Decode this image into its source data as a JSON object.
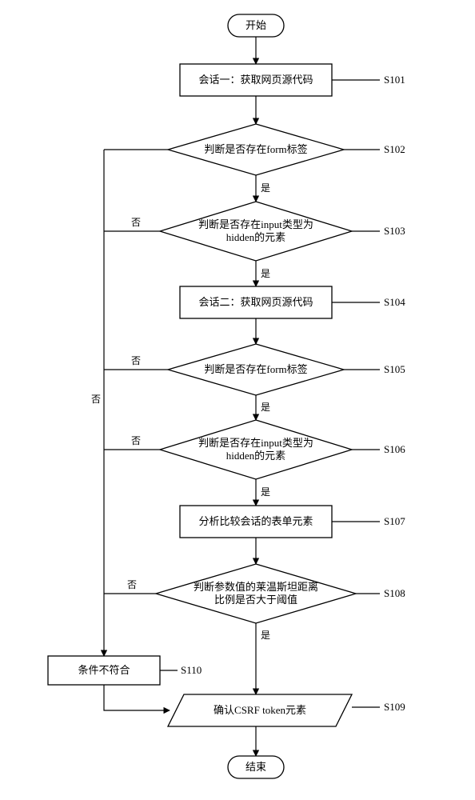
{
  "chart_data": {
    "type": "flowchart",
    "title": "",
    "nodes": [
      {
        "id": "start",
        "type": "terminator",
        "text": "开始"
      },
      {
        "id": "n101",
        "type": "process",
        "text": "会话一：获取网页源代码",
        "label": "S101"
      },
      {
        "id": "n102",
        "type": "decision",
        "text": "判断是否存在form标签",
        "label": "S102"
      },
      {
        "id": "n103",
        "type": "decision",
        "text_l1": "判断是否存在input类型为",
        "text_l2": "hidden的元素",
        "label": "S103"
      },
      {
        "id": "n104",
        "type": "process",
        "text": "会话二：获取网页源代码",
        "label": "S104"
      },
      {
        "id": "n105",
        "type": "decision",
        "text": "判断是否存在form标签",
        "label": "S105"
      },
      {
        "id": "n106",
        "type": "decision",
        "text_l1": "判断是否存在input类型为",
        "text_l2": "hidden的元素",
        "label": "S106"
      },
      {
        "id": "n107",
        "type": "process",
        "text": "分析比较会话的表单元素",
        "label": "S107"
      },
      {
        "id": "n108",
        "type": "decision",
        "text_l1": "判断参数值的莱温斯坦距离",
        "text_l2": "比例是否大于阈值",
        "label": "S108"
      },
      {
        "id": "n109",
        "type": "data",
        "text": "确认CSRF token元素",
        "label": "S109"
      },
      {
        "id": "n110",
        "type": "process",
        "text": "条件不符合",
        "label": "S110"
      },
      {
        "id": "end",
        "type": "terminator",
        "text": "结束"
      }
    ],
    "edge_labels": {
      "yes": "是",
      "no": "否"
    }
  }
}
